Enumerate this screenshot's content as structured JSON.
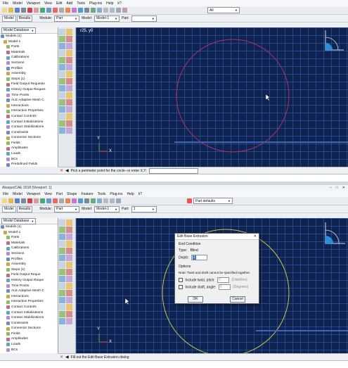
{
  "top": {
    "menu": [
      "File",
      "Model",
      "Viewport",
      "View",
      "Edit",
      "Add",
      "Tools",
      "Plug-ins",
      "Help",
      "k?"
    ],
    "tabs": [
      "Model",
      "Results"
    ],
    "module_label": "Module:",
    "module_value": "Part",
    "model_label": "Model:",
    "model_value": "Model-1",
    "part_label": "Part:",
    "part_value": "",
    "all_value": "All",
    "tree_head": "Model Database",
    "tree": [
      "Models (1)",
      "Model-1",
      "Parts",
      "Materials",
      "Calibrations",
      "Sections",
      "Profiles",
      "Assembly",
      "Steps (1)",
      "Field Output Requests",
      "History Output Reques",
      "Time Points",
      "ALE Adaptive Mesh C",
      "Interactions",
      "Interaction Properties",
      "Contact Controls",
      "Contact Initializations",
      "Contact Stabilizations",
      "Constraints",
      "Connector Sections",
      "Fields",
      "Amplitudes",
      "Loads",
      "BCs",
      "Predefined Fields"
    ],
    "coord_readout": "r25, y0",
    "prompt_text": "Pick a perimeter point for the circle--or enter X,Y:",
    "axis_y": "Y",
    "axis_x": "X"
  },
  "bottom": {
    "window_title": "Abaqus/CAE 2018 [Viewport: 1]",
    "menu": [
      "File",
      "Model",
      "Viewport",
      "View",
      "Part",
      "Shape",
      "Feature",
      "Tools",
      "Plug-ins",
      "Help",
      "k?"
    ],
    "tabs": [
      "Model",
      "Results"
    ],
    "module_label": "Module:",
    "module_value": "Part",
    "model_label": "Model:",
    "model_value": "Model-1",
    "part_label": "Part:",
    "part_value": "1",
    "part_defaults": "Part defaults",
    "tree_head": "Model Database",
    "tree": [
      "Models (1)",
      "Model-1",
      "Parts",
      "Materials",
      "Calibrations",
      "Sections",
      "Profiles",
      "Assembly",
      "Steps (1)",
      "Field Output Reque",
      "History Output Reque",
      "Time Points",
      "ALE Adaptive Mesh C",
      "Interactions",
      "Interaction Properties",
      "Contact Controls",
      "Contact Initializations",
      "Contact Stabilizations",
      "Constraints",
      "Connector Sections",
      "Fields",
      "Amplitudes",
      "Loads",
      "BCs"
    ],
    "prompt_text": "Fill out the Edit Base Extrusion dialog",
    "axis_y": "Y",
    "axis_x": "X"
  },
  "dialog": {
    "title": "Edit Base Extrusion",
    "section_end": "End Condition",
    "type_label": "Type:",
    "type_value": "Blind",
    "depth_label": "Depth:",
    "depth_value": "1",
    "options_label": "Options",
    "note": "Note:  Twist and draft cannot be specified together.",
    "twist_label": "Include twist, pitch:",
    "twist_value": "0",
    "twist_unit": "(Dist/Rev)",
    "draft_label": "Include draft, angle:",
    "draft_value": "0",
    "draft_unit": "(Degrees)",
    "ok": "OK",
    "cancel": "Cancel"
  },
  "colors": {
    "viewport_bg": "#0e2350",
    "sketch_circle_top": "#b0306a",
    "sketch_circle_bottom": "#c8c44a",
    "triad_green": "#2bb24c",
    "triad_red": "#e23b3b"
  }
}
